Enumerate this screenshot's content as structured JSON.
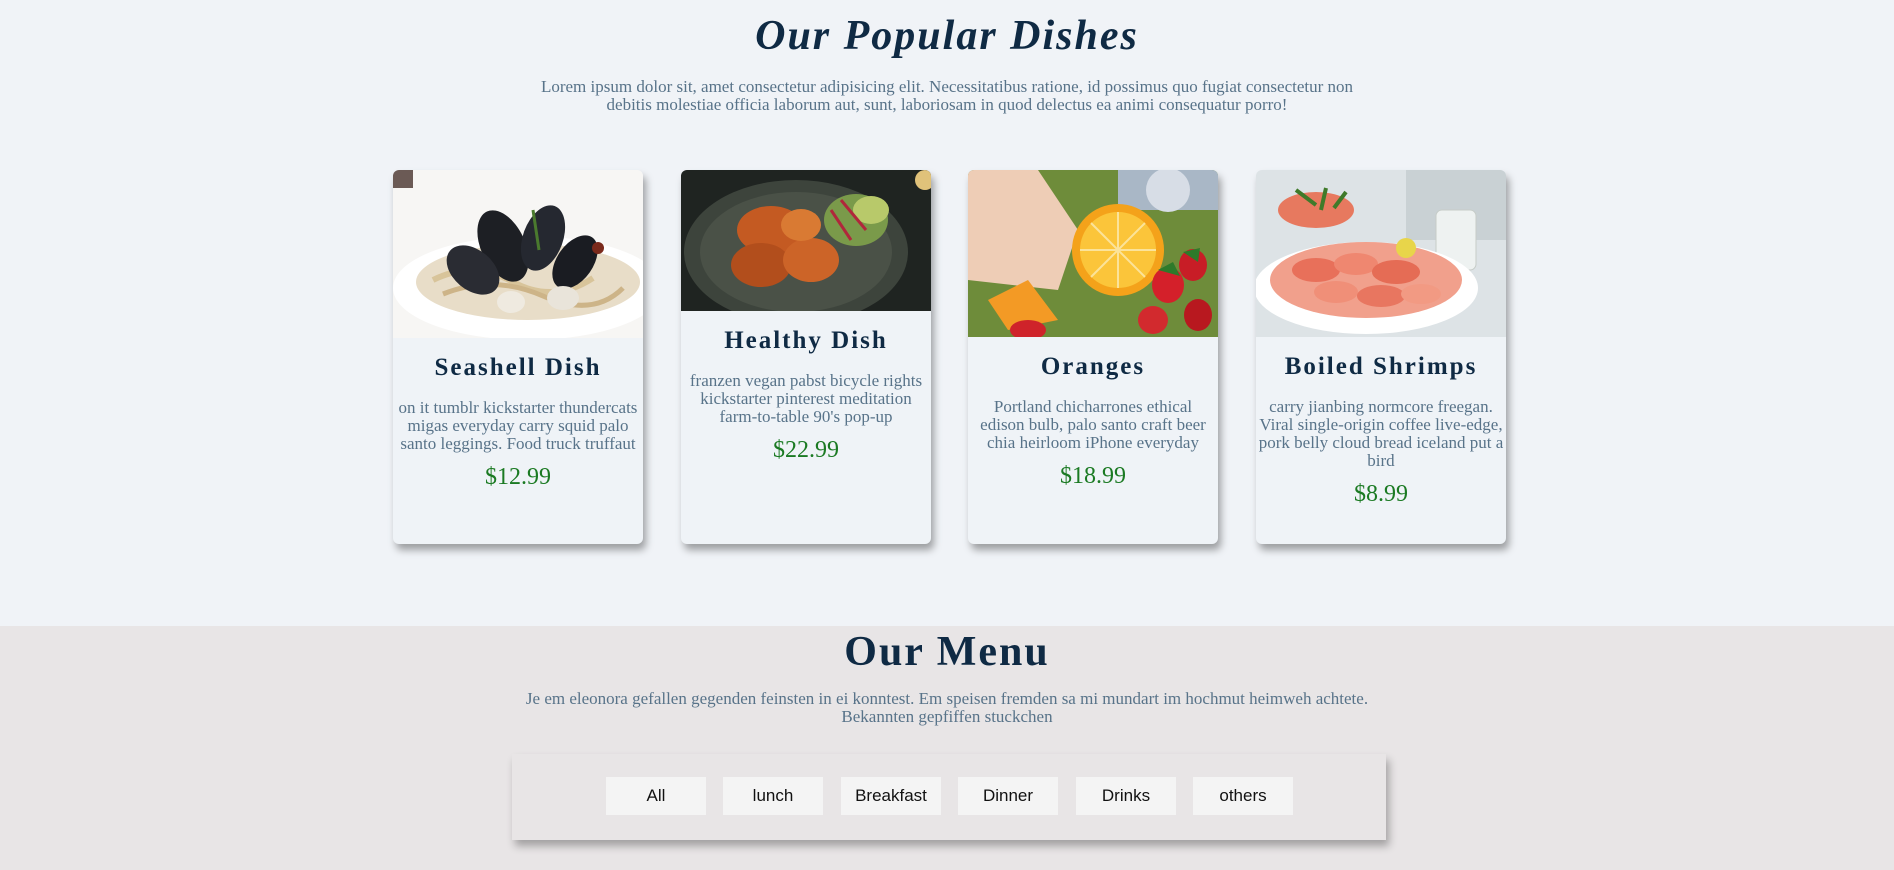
{
  "popular": {
    "title": "Our Popular Dishes",
    "description": "Lorem ipsum dolor sit, amet consectetur adipisicing elit. Necessitatibus ratione, id possimus quo fugiat consectetur non debitis molestiae officia laborum aut, sunt, laboriosam in quod delectus ea animi consequatur porro!",
    "dishes": [
      {
        "title": "Seashell Dish",
        "description": "on it tumblr kickstarter thundercats migas everyday carry squid palo santo leggings. Food truck truffaut",
        "price": "$12.99",
        "image": "mussels-pasta-photo"
      },
      {
        "title": "Healthy Dish",
        "description": "franzen vegan pabst bicycle rights kickstarter pinterest meditation farm-to-table 90's pop-up",
        "price": "$22.99",
        "image": "fritters-salad-photo"
      },
      {
        "title": "Oranges",
        "description": "Portland chicharrones ethical edison bulb, palo santo craft beer chia heirloom iPhone everyday",
        "price": "$18.99",
        "image": "oranges-strawberries-photo"
      },
      {
        "title": "Boiled Shrimps",
        "description": "carry jianbing normcore freegan. Viral single-origin coffee live-edge, pork belly cloud bread iceland put a bird",
        "price": "$8.99",
        "image": "shrimp-platter-photo"
      }
    ]
  },
  "menu": {
    "title": "Our Menu",
    "description": "Je em eleonora gefallen gegenden feinsten in ei konntest. Em speisen fremden sa mi mundart im hochmut heimweh achtete. Bekannten gepfiffen stuckchen",
    "filters": [
      "All",
      "lunch",
      "Breakfast",
      "Dinner",
      "Drinks",
      "others"
    ]
  },
  "colors": {
    "heading": "#0f2a44",
    "body_text": "#587389",
    "price": "#1b7a23",
    "popular_bg": "#f0f3f7",
    "menu_bg": "#e8e5e6"
  }
}
